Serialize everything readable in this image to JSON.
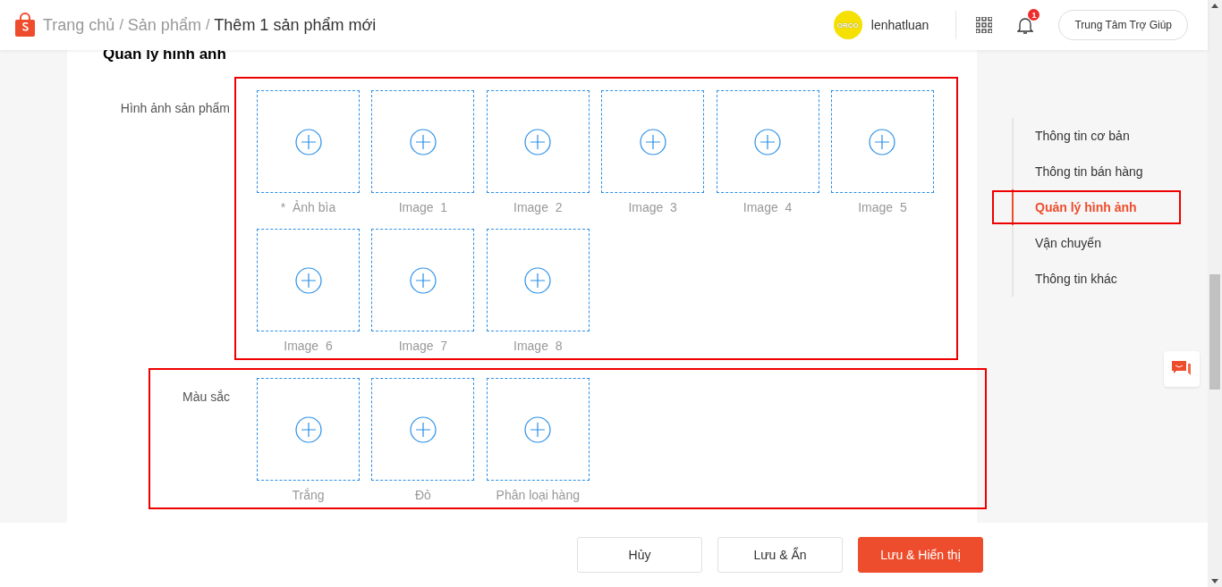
{
  "header": {
    "breadcrumb": [
      {
        "label": "Trang chủ",
        "current": false
      },
      {
        "label": "/",
        "kind": "separator"
      },
      {
        "label": "Sản phẩm",
        "current": false
      },
      {
        "label": "/",
        "kind": "separator"
      },
      {
        "label": "Thêm 1 sản phẩm mới",
        "current": true
      }
    ],
    "avatar_text": "ORCO",
    "username": "lenhatluan",
    "notification_count": "1",
    "help_button": "Trung Tâm Trợ Giúp"
  },
  "section_title": "Quản lý hình ảnh",
  "sections": [
    {
      "label": "Hình ảnh sản phẩm",
      "frame_includes_label": false,
      "tiles": [
        "*  Ảnh bìa",
        "Image  1",
        "Image  2",
        "Image  3",
        "Image  4",
        "Image  5",
        "Image  6",
        "Image  7",
        "Image  8"
      ]
    },
    {
      "label": "Màu sắc",
      "frame_includes_label": true,
      "tiles": [
        "Trắng",
        "Đỏ",
        "Phân loại hàng"
      ]
    }
  ],
  "nav": [
    {
      "label": "Thông tin cơ bản",
      "selected": false,
      "annotated": false
    },
    {
      "label": "Thông tin bán hàng",
      "selected": false,
      "annotated": false
    },
    {
      "label": "Quản lý hình ảnh",
      "selected": true,
      "annotated": true
    },
    {
      "label": "Vận chuyển",
      "selected": false,
      "annotated": false
    },
    {
      "label": "Thông tin khác",
      "selected": false,
      "annotated": false
    }
  ],
  "footer_buttons": [
    {
      "label": "Hủy",
      "kind": "secondary"
    },
    {
      "label": "Lưu & Ẩn",
      "kind": "secondary"
    },
    {
      "label": "Lưu & Hiển thị",
      "kind": "primary"
    }
  ]
}
